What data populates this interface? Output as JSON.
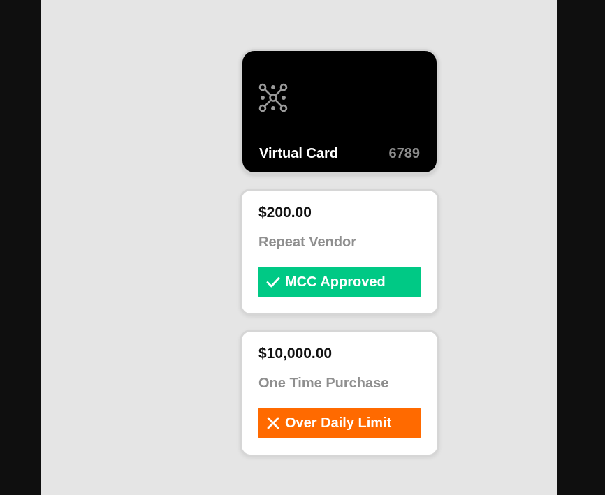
{
  "virtual_card": {
    "logo_icon": "cluster-dots-icon",
    "label": "Virtual Card",
    "last4": "6789"
  },
  "transactions": [
    {
      "amount": "$200.00",
      "description": "Repeat Vendor",
      "status": {
        "label": "MCC Approved",
        "icon": "checkmark-icon",
        "color": "#00c985"
      }
    },
    {
      "amount": "$10,000.00",
      "description": "One Time Purchase",
      "status": {
        "label": "Over Daily Limit",
        "icon": "x-icon",
        "color": "#ff6a00"
      }
    }
  ]
}
